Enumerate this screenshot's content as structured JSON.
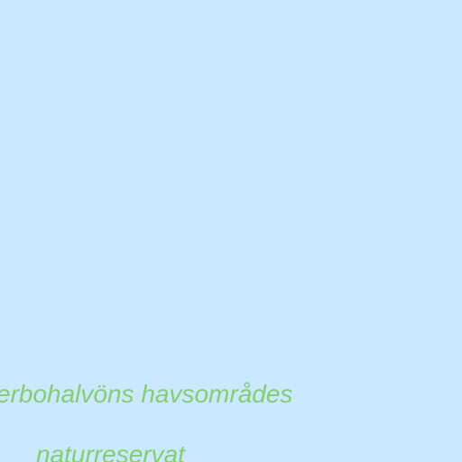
{
  "map": {
    "water_color": "#cae8ff",
    "label_color": "#84cf6d",
    "label": {
      "line1": "erbohalvöns havsområdes",
      "line2": "naturreservat"
    }
  }
}
